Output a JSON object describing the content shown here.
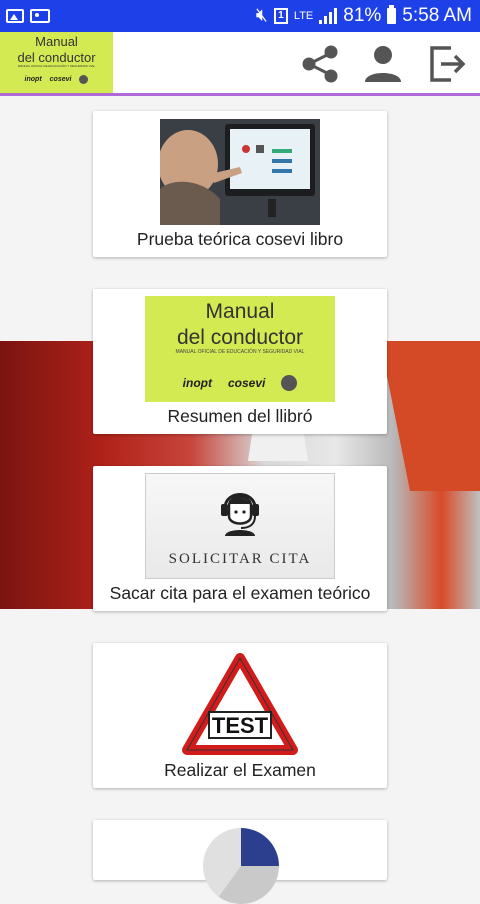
{
  "status_bar": {
    "lte": "LTE",
    "sim": "1",
    "battery": "81%",
    "time": "5:58 AM"
  },
  "app_bar": {
    "logo": {
      "title_line1": "Manual",
      "title_line2": "del conductor",
      "subtitle": "MANUAL OFICIAL DE EDUCACIÓN Y SEGURIDAD VIAL",
      "brand1": "inopt",
      "brand2": "cosevi"
    },
    "icons": [
      "share-icon",
      "person-icon",
      "exit-icon"
    ]
  },
  "cards": [
    {
      "label": "Prueba teórica cosevi  libro",
      "image": "person-at-touchscreen-photo"
    },
    {
      "label": "Resumen del llibró",
      "image_text": {
        "title_line1": "Manual",
        "title_line2": "del conductor",
        "subtitle": "MANUAL OFICIAL DE EDUCACIÓN Y SEGURIDAD VIAL",
        "brand1": "inopt",
        "brand2": "cosevi"
      }
    },
    {
      "label": "Sacar cita para el examen teórico",
      "image_text": "SOLICITAR CITA"
    },
    {
      "label": "Realizar el Examen",
      "image_text": "TEST"
    },
    {
      "label": "",
      "image": "pie-chart-partial"
    }
  ],
  "colors": {
    "status_bar": "#1e40e8",
    "app_bar_divider": "#b06ad8",
    "manual_green": "#d4ea52",
    "icon_gray": "#555555"
  }
}
